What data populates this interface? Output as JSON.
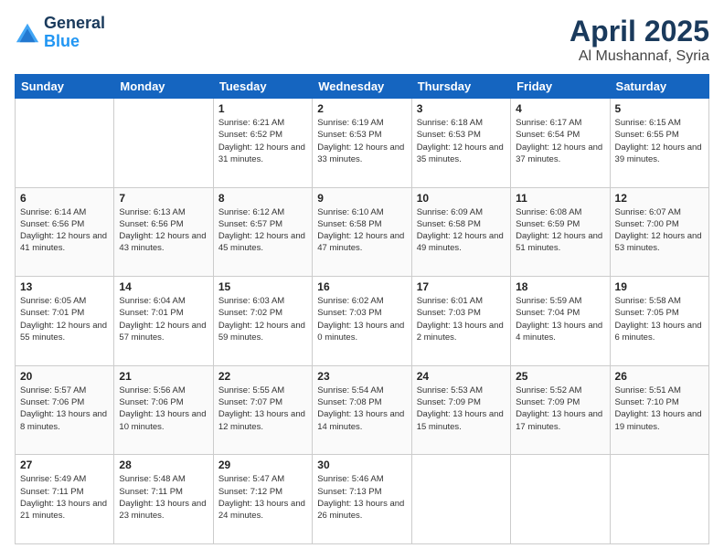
{
  "logo": {
    "line1": "General",
    "line2": "Blue"
  },
  "title": "April 2025",
  "subtitle": "Al Mushannaf, Syria",
  "days_header": [
    "Sunday",
    "Monday",
    "Tuesday",
    "Wednesday",
    "Thursday",
    "Friday",
    "Saturday"
  ],
  "weeks": [
    [
      {
        "day": "",
        "sunrise": "",
        "sunset": "",
        "daylight": ""
      },
      {
        "day": "",
        "sunrise": "",
        "sunset": "",
        "daylight": ""
      },
      {
        "day": "1",
        "sunrise": "Sunrise: 6:21 AM",
        "sunset": "Sunset: 6:52 PM",
        "daylight": "Daylight: 12 hours and 31 minutes."
      },
      {
        "day": "2",
        "sunrise": "Sunrise: 6:19 AM",
        "sunset": "Sunset: 6:53 PM",
        "daylight": "Daylight: 12 hours and 33 minutes."
      },
      {
        "day": "3",
        "sunrise": "Sunrise: 6:18 AM",
        "sunset": "Sunset: 6:53 PM",
        "daylight": "Daylight: 12 hours and 35 minutes."
      },
      {
        "day": "4",
        "sunrise": "Sunrise: 6:17 AM",
        "sunset": "Sunset: 6:54 PM",
        "daylight": "Daylight: 12 hours and 37 minutes."
      },
      {
        "day": "5",
        "sunrise": "Sunrise: 6:15 AM",
        "sunset": "Sunset: 6:55 PM",
        "daylight": "Daylight: 12 hours and 39 minutes."
      }
    ],
    [
      {
        "day": "6",
        "sunrise": "Sunrise: 6:14 AM",
        "sunset": "Sunset: 6:56 PM",
        "daylight": "Daylight: 12 hours and 41 minutes."
      },
      {
        "day": "7",
        "sunrise": "Sunrise: 6:13 AM",
        "sunset": "Sunset: 6:56 PM",
        "daylight": "Daylight: 12 hours and 43 minutes."
      },
      {
        "day": "8",
        "sunrise": "Sunrise: 6:12 AM",
        "sunset": "Sunset: 6:57 PM",
        "daylight": "Daylight: 12 hours and 45 minutes."
      },
      {
        "day": "9",
        "sunrise": "Sunrise: 6:10 AM",
        "sunset": "Sunset: 6:58 PM",
        "daylight": "Daylight: 12 hours and 47 minutes."
      },
      {
        "day": "10",
        "sunrise": "Sunrise: 6:09 AM",
        "sunset": "Sunset: 6:58 PM",
        "daylight": "Daylight: 12 hours and 49 minutes."
      },
      {
        "day": "11",
        "sunrise": "Sunrise: 6:08 AM",
        "sunset": "Sunset: 6:59 PM",
        "daylight": "Daylight: 12 hours and 51 minutes."
      },
      {
        "day": "12",
        "sunrise": "Sunrise: 6:07 AM",
        "sunset": "Sunset: 7:00 PM",
        "daylight": "Daylight: 12 hours and 53 minutes."
      }
    ],
    [
      {
        "day": "13",
        "sunrise": "Sunrise: 6:05 AM",
        "sunset": "Sunset: 7:01 PM",
        "daylight": "Daylight: 12 hours and 55 minutes."
      },
      {
        "day": "14",
        "sunrise": "Sunrise: 6:04 AM",
        "sunset": "Sunset: 7:01 PM",
        "daylight": "Daylight: 12 hours and 57 minutes."
      },
      {
        "day": "15",
        "sunrise": "Sunrise: 6:03 AM",
        "sunset": "Sunset: 7:02 PM",
        "daylight": "Daylight: 12 hours and 59 minutes."
      },
      {
        "day": "16",
        "sunrise": "Sunrise: 6:02 AM",
        "sunset": "Sunset: 7:03 PM",
        "daylight": "Daylight: 13 hours and 0 minutes."
      },
      {
        "day": "17",
        "sunrise": "Sunrise: 6:01 AM",
        "sunset": "Sunset: 7:03 PM",
        "daylight": "Daylight: 13 hours and 2 minutes."
      },
      {
        "day": "18",
        "sunrise": "Sunrise: 5:59 AM",
        "sunset": "Sunset: 7:04 PM",
        "daylight": "Daylight: 13 hours and 4 minutes."
      },
      {
        "day": "19",
        "sunrise": "Sunrise: 5:58 AM",
        "sunset": "Sunset: 7:05 PM",
        "daylight": "Daylight: 13 hours and 6 minutes."
      }
    ],
    [
      {
        "day": "20",
        "sunrise": "Sunrise: 5:57 AM",
        "sunset": "Sunset: 7:06 PM",
        "daylight": "Daylight: 13 hours and 8 minutes."
      },
      {
        "day": "21",
        "sunrise": "Sunrise: 5:56 AM",
        "sunset": "Sunset: 7:06 PM",
        "daylight": "Daylight: 13 hours and 10 minutes."
      },
      {
        "day": "22",
        "sunrise": "Sunrise: 5:55 AM",
        "sunset": "Sunset: 7:07 PM",
        "daylight": "Daylight: 13 hours and 12 minutes."
      },
      {
        "day": "23",
        "sunrise": "Sunrise: 5:54 AM",
        "sunset": "Sunset: 7:08 PM",
        "daylight": "Daylight: 13 hours and 14 minutes."
      },
      {
        "day": "24",
        "sunrise": "Sunrise: 5:53 AM",
        "sunset": "Sunset: 7:09 PM",
        "daylight": "Daylight: 13 hours and 15 minutes."
      },
      {
        "day": "25",
        "sunrise": "Sunrise: 5:52 AM",
        "sunset": "Sunset: 7:09 PM",
        "daylight": "Daylight: 13 hours and 17 minutes."
      },
      {
        "day": "26",
        "sunrise": "Sunrise: 5:51 AM",
        "sunset": "Sunset: 7:10 PM",
        "daylight": "Daylight: 13 hours and 19 minutes."
      }
    ],
    [
      {
        "day": "27",
        "sunrise": "Sunrise: 5:49 AM",
        "sunset": "Sunset: 7:11 PM",
        "daylight": "Daylight: 13 hours and 21 minutes."
      },
      {
        "day": "28",
        "sunrise": "Sunrise: 5:48 AM",
        "sunset": "Sunset: 7:11 PM",
        "daylight": "Daylight: 13 hours and 23 minutes."
      },
      {
        "day": "29",
        "sunrise": "Sunrise: 5:47 AM",
        "sunset": "Sunset: 7:12 PM",
        "daylight": "Daylight: 13 hours and 24 minutes."
      },
      {
        "day": "30",
        "sunrise": "Sunrise: 5:46 AM",
        "sunset": "Sunset: 7:13 PM",
        "daylight": "Daylight: 13 hours and 26 minutes."
      },
      {
        "day": "",
        "sunrise": "",
        "sunset": "",
        "daylight": ""
      },
      {
        "day": "",
        "sunrise": "",
        "sunset": "",
        "daylight": ""
      },
      {
        "day": "",
        "sunrise": "",
        "sunset": "",
        "daylight": ""
      }
    ]
  ]
}
